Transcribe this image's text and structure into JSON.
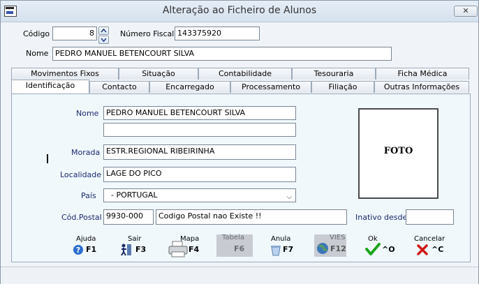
{
  "window": {
    "title": "Alteração ao Ficheiro de Alunos",
    "close_label": "✕"
  },
  "header": {
    "codigo_label": "Código",
    "codigo_value": "8",
    "nif_label": "Número Fiscal",
    "nif_value": "143375920",
    "nome_label": "Nome",
    "nome_value": "PEDRO MANUEL BETENCOURT SILVA"
  },
  "tabs_row1": [
    "Movimentos Fixos",
    "Situação",
    "Contabilidade",
    "Tesouraria",
    "Ficha Médica"
  ],
  "tabs_row2": [
    "Identificação",
    "Contacto",
    "Encarregado",
    "Processamento",
    "Filiação",
    "Outras Informações"
  ],
  "form": {
    "nome_label": "Nome",
    "nome_value": "PEDRO MANUEL BETENCOURT SILVA",
    "nome2_value": "",
    "morada_label": "Morada",
    "morada_value": "ESTR.REGIONAL RIBEIRINHA",
    "localidade_label": "Localidade",
    "localidade_value": "LAGE DO PICO",
    "pais_label": "País",
    "pais_value": "  - PORTUGAL",
    "codpostal_label": "Cód.Postal",
    "codpostal_value": "9930-000",
    "codpostal_desc": "Codigo Postal nao Existe !!",
    "inativo_label": "Inativo desde",
    "inativo_value": "",
    "foto_label": "FOTO"
  },
  "functions": [
    {
      "label": "Ajuda",
      "key": "F1",
      "icon": "help-icon"
    },
    {
      "label": "Sair",
      "key": "F3",
      "icon": "exit-icon"
    },
    {
      "label": "Mapa",
      "key": "F4",
      "icon": "printer-icon"
    },
    {
      "label": "Tabela",
      "key": "F6",
      "icon": "table-icon"
    },
    {
      "label": "Anula",
      "key": "F7",
      "icon": "delete-icon"
    },
    {
      "label": "VIES",
      "key": "F12",
      "icon": "globe-icon"
    },
    {
      "label": "Ok",
      "key": "^O",
      "icon": "check-icon"
    },
    {
      "label": "Cancelar",
      "key": "^C",
      "icon": "cancel-icon"
    }
  ]
}
